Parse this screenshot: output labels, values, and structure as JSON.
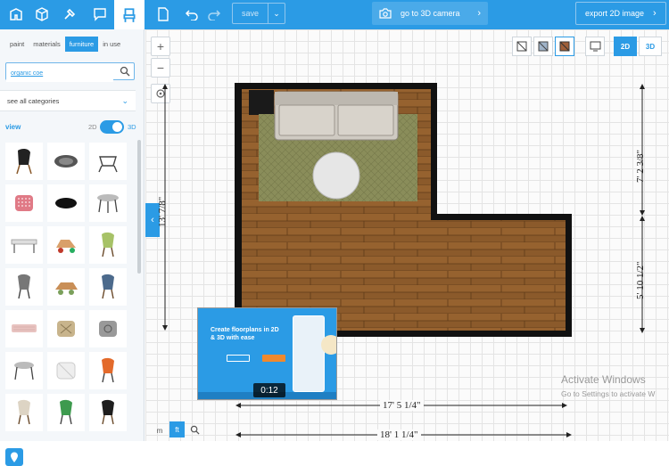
{
  "toolbar": {
    "save_label": "save",
    "camera_label": "go to 3D camera",
    "export_label": "export 2D image"
  },
  "sidebar": {
    "tabs": [
      "paint",
      "materials",
      "furniture",
      "in use"
    ],
    "active_tab": "furniture",
    "search_value": "organic coe",
    "categories_label": "see all categories",
    "view_label": "view",
    "view_2d": "2D",
    "view_3d": "3D"
  },
  "canvas": {
    "mode_2d": "2D",
    "mode_3d": "3D",
    "dimensions": {
      "width_inner": "17' 5 1/4\"",
      "width_outer": "18' 1 1/4\"",
      "left_height": "13' 7/8\"",
      "right_upper": "7' 2 3/8\"",
      "right_lower": "5' 10 1/2\""
    },
    "bottom_m": "m",
    "bottom_ft": "ft"
  },
  "video": {
    "title": "Create floorplans in 2D & 3D with ease",
    "time": "0:12"
  },
  "watermark": {
    "line1": "Activate Windows",
    "line2": "Go to Settings to activate W"
  },
  "colors": {
    "accent": "#2b9be5",
    "wall": "#111111",
    "floor": "#8b5a2b",
    "rug": "#8a8d5a"
  }
}
